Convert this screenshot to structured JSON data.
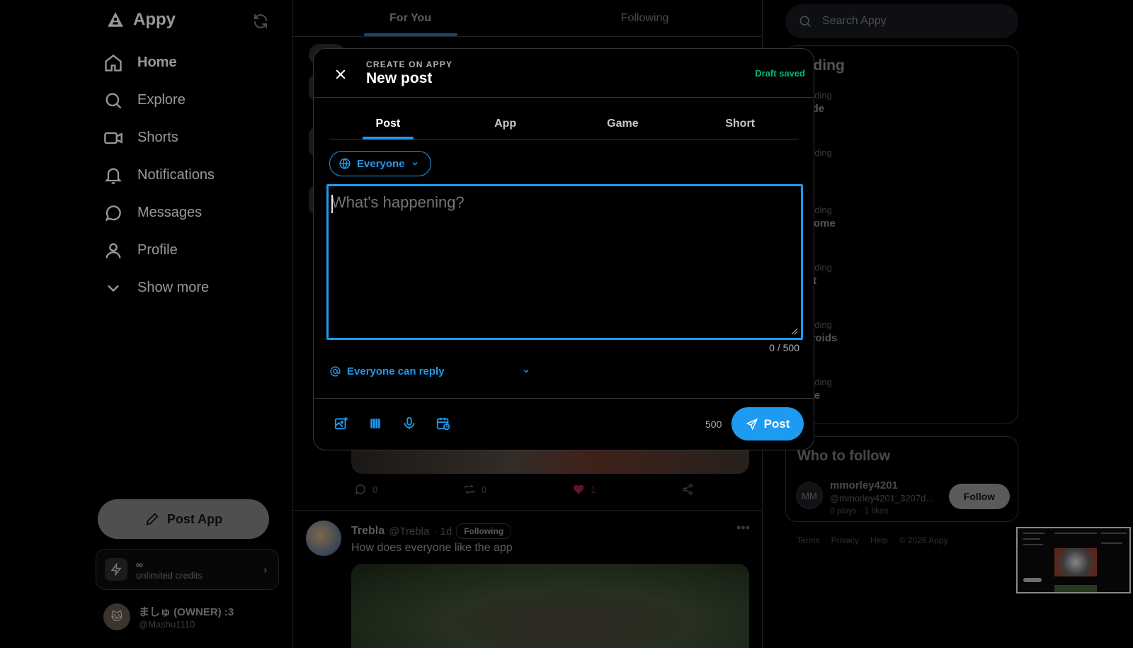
{
  "colors": {
    "accent": "#1d9bf0",
    "draft_green": "#00ba7c",
    "background": "#000000"
  },
  "sidebar": {
    "brand": "Appy",
    "nav": [
      {
        "label": "Home",
        "icon": "home-icon"
      },
      {
        "label": "Explore",
        "icon": "search-icon"
      },
      {
        "label": "Shorts",
        "icon": "video-icon"
      },
      {
        "label": "Notifications",
        "icon": "bell-icon"
      },
      {
        "label": "Messages",
        "icon": "message-icon"
      },
      {
        "label": "Profile",
        "icon": "user-icon"
      },
      {
        "label": "Show more",
        "icon": "chevron-down-icon"
      }
    ],
    "post_button": "Post App",
    "credits": {
      "title": "∞",
      "subtitle": "unlimited credits"
    },
    "user": {
      "name": "ましゅ (OWNER) :3",
      "handle": "@Mashu1110"
    }
  },
  "feed": {
    "tabs": [
      "For You",
      "Following"
    ],
    "post": {
      "replies": "0",
      "reposts": "0",
      "likes": "1"
    },
    "post2": {
      "name": "Trebla",
      "handle": "@Trebla",
      "time": "· 1d",
      "badge": "Following",
      "text": "How does everyone like the app"
    }
  },
  "right": {
    "search_placeholder": "Search Appy",
    "trending_title": "ending",
    "trends": [
      {
        "label": "Trending",
        "name": "rcade",
        "count": "osts"
      },
      {
        "label": "Trending",
        "name": "ppy",
        "count": "ost"
      },
      {
        "label": "Trending",
        "name": "/elcome",
        "count": "ost"
      },
      {
        "label": "Trending",
        "name": "hort",
        "count": "osts"
      },
      {
        "label": "Trending",
        "name": "steroids",
        "count": "osts"
      },
      {
        "label": "Trending",
        "name": "pace",
        "count": "osts"
      }
    ],
    "who_to_follow": {
      "title": "Who to follow",
      "initials": "MM",
      "name": "mmorley4201",
      "handle": "@mmorley4201_3207d...",
      "stats": "0 plays · 1 likes",
      "follow": "Follow"
    },
    "footer": [
      "Terms",
      "Privacy",
      "Help",
      "© 2026 Appy"
    ]
  },
  "modal": {
    "eyebrow": "CREATE ON APPY",
    "title": "New post",
    "draft_status": "Draft saved",
    "tabs": [
      "Post",
      "App",
      "Game",
      "Short"
    ],
    "audience": "Everyone",
    "placeholder": "What's happening?",
    "value": "",
    "counter": "0 / 500",
    "reply_setting": "Everyone can reply",
    "remaining": "500",
    "submit": "Post"
  }
}
